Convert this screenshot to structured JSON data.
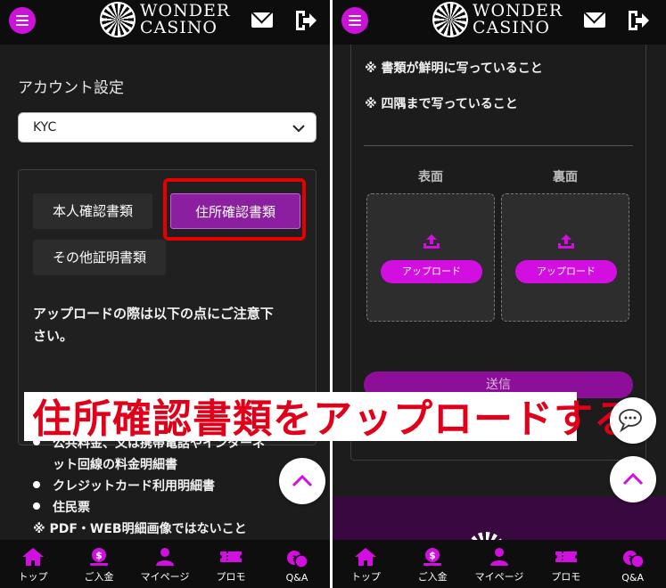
{
  "header": {
    "logo_line1": "WONDER",
    "logo_line2": "CASINO"
  },
  "left": {
    "section_title": "アカウント設定",
    "select": {
      "value": "KYC"
    },
    "tabs": [
      {
        "label": "本人確認書類",
        "active": false
      },
      {
        "label": "住所確認書類",
        "active": true
      },
      {
        "label": "その他証明書類",
        "active": false
      }
    ],
    "notice_line1": "アップロードの際は以下の点にご注意下",
    "notice_line2": "さい。",
    "bullets": [
      {
        "line1": "公共料金、又は携帯電話やインターネ",
        "line2": "ット回線の料金明細書"
      },
      {
        "line1": "クレジットカード利用明細書"
      },
      {
        "line1": "住民票"
      }
    ],
    "pdf_note": "※ PDF・WEB明細画像ではないこと"
  },
  "right": {
    "checks": [
      "※ 書類が鮮明に写っていること",
      "※ 四隅まで写っていること"
    ],
    "front_label": "表面",
    "back_label": "裏面",
    "upload_label": "アップロード",
    "submit_label": "送信"
  },
  "nav": [
    {
      "label": "トップ",
      "icon": "home-icon"
    },
    {
      "label": "ご入金",
      "icon": "deposit-icon"
    },
    {
      "label": "マイページ",
      "icon": "user-icon"
    },
    {
      "label": "プロモ",
      "icon": "ticket-icon"
    },
    {
      "label": "Q&A",
      "icon": "qa-icon"
    }
  ],
  "banner": "住所確認書類をアップロードする",
  "colors": {
    "accent": "#d20fe0",
    "active_tab": "#8c1fa0",
    "highlight_border": "#e60000",
    "banner_text": "#e1001a"
  }
}
